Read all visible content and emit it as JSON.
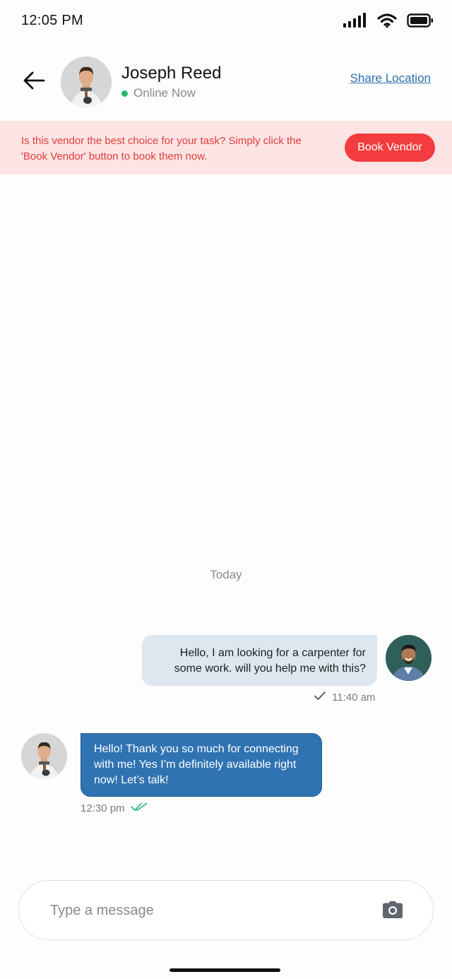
{
  "status_bar": {
    "time": "12:05 PM",
    "icons": [
      "signal-icon",
      "wifi-icon",
      "battery-icon"
    ]
  },
  "header": {
    "contact_name": "Joseph Reed",
    "online_status": "Online Now",
    "share_location": "Share Location",
    "icons": [
      "back-arrow-icon"
    ]
  },
  "banner": {
    "text": "Is this vendor the best choice for your task? Simply click the 'Book Vendor' button to book them now.",
    "button_label": "Book Vendor"
  },
  "chat": {
    "day_label": "Today",
    "messages": [
      {
        "direction": "outgoing",
        "text": "Hello, I am looking for a carpenter for some work. will you help me with this?",
        "time": "11:40 am",
        "status_icon": "single-check-icon"
      },
      {
        "direction": "incoming",
        "text": "Hello! Thank you so much for connecting with me! Yes I’m definitely available right now! Let’s talk!",
        "time": "12:30 pm",
        "status_icon": "double-check-icon"
      }
    ]
  },
  "composer": {
    "placeholder": "Type a message",
    "value": "",
    "icons": [
      "camera-icon"
    ]
  },
  "colors": {
    "accent_blue": "#2f73b2",
    "outgoing_bubble": "#dde7f0",
    "banner_bg": "#fde4e4",
    "banner_text": "#e23c3c",
    "book_button": "#f33c3f",
    "online_dot": "#2bb673",
    "read_check": "#2bb673"
  }
}
